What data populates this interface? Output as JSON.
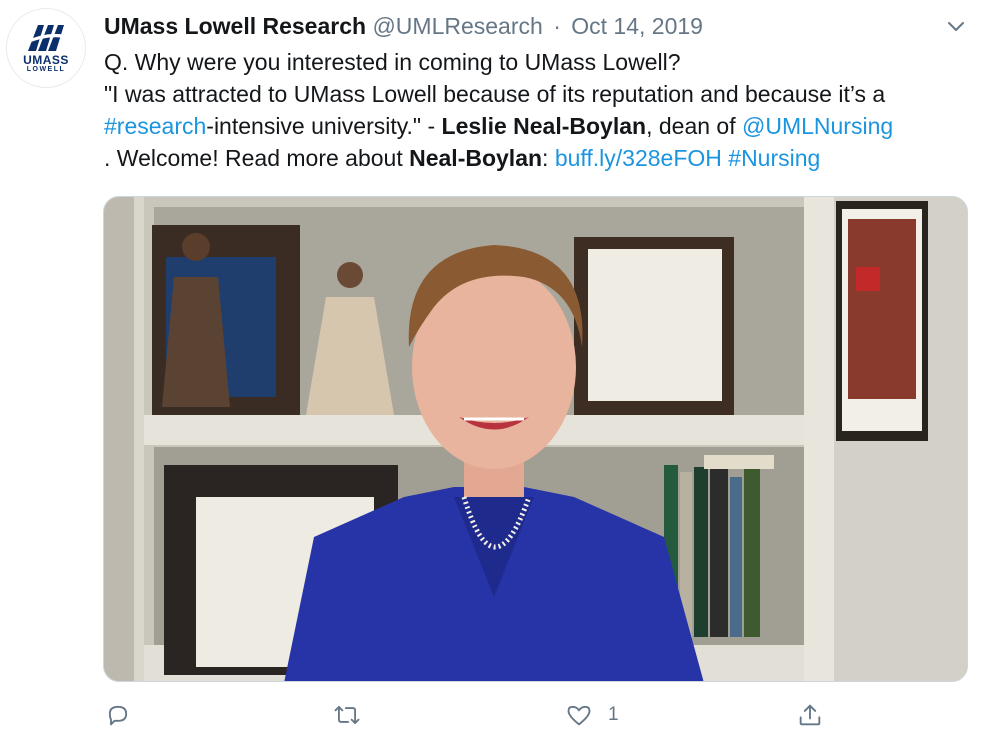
{
  "account": {
    "display_name": "UMass Lowell Research",
    "handle": "@UMLResearch",
    "separator": "·",
    "date": "Oct 14, 2019",
    "logo_text": "UMASS",
    "logo_subtext": "LOWELL"
  },
  "tweet": {
    "line1": "Q. Why were you interested in coming to UMass Lowell?",
    "line2": "\"I was attracted to UMass Lowell because of its reputation and because it’s a",
    "hashtag_research": "#research",
    "line3_text": "-intensive university.\" - ",
    "name_bold": "Leslie Neal-Boylan",
    "line3_after": ", dean of ",
    "mention": "@UMLNursing",
    "line4_start": ". Welcome! Read more about ",
    "name_bold_short": "Neal-Boylan",
    "line4_colon": ": ",
    "url": "buff.ly/328eFOH",
    "hashtag_nursing": "#Nursing"
  },
  "actions": {
    "reply_icon": "reply-icon",
    "retweet_icon": "retweet-icon",
    "like_icon": "heart-icon",
    "like_count": "1",
    "share_icon": "share-icon"
  },
  "colors": {
    "link": "#1b95e0",
    "muted": "#657786",
    "text": "#14171a",
    "brand_navy": "#0b2f6b"
  }
}
